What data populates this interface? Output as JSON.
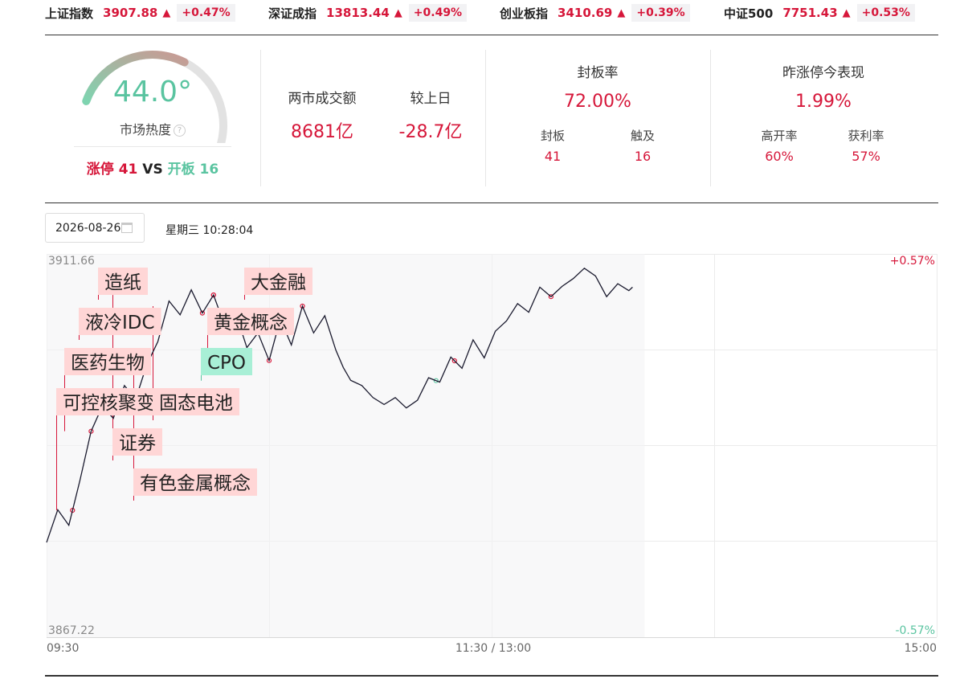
{
  "indices": [
    {
      "name": "上证指数",
      "value": "3907.88",
      "change": "+0.47%"
    },
    {
      "name": "深证成指",
      "value": "13813.44",
      "change": "+0.49%"
    },
    {
      "name": "创业板指",
      "value": "3410.69",
      "change": "+0.39%"
    },
    {
      "name": "中证500",
      "value": "7751.43",
      "change": "+0.53%"
    }
  ],
  "arrow_up": "▲",
  "heat": {
    "value": "44.0°",
    "heat_fraction": 0.44,
    "label": "市场热度",
    "help": "?",
    "limit_up_label": "涨停",
    "limit_up_count": "41",
    "vs": "VS",
    "open_label": "开板",
    "open_count": "16"
  },
  "turnover": {
    "label": "两市成交额",
    "value": "8681亿",
    "compare_label": "较上日",
    "compare_value": "-28.7亿"
  },
  "seal_rate": {
    "label": "封板率",
    "value": "72.00%",
    "sealed_label": "封板",
    "sealed_value": "41",
    "touched_label": "触及",
    "touched_value": "16"
  },
  "yesterday_limit_up": {
    "label": "昨涨停今表现",
    "value": "1.99%",
    "high_open_label": "高开率",
    "high_open_value": "60%",
    "profit_label": "获利率",
    "profit_value": "57%"
  },
  "date_picker": {
    "value": "2026-08-26"
  },
  "weekday_time": "星期三 10:28:04",
  "colors": {
    "up": "#d6173a",
    "down": "#5ac4a0",
    "accent": "#5ac4a0"
  },
  "chart_data": {
    "type": "line",
    "y_max_label": "3911.66",
    "y_min_label": "3867.22",
    "pct_max_label": "+0.57%",
    "pct_min_label": "-0.57%",
    "x_tick_labels": [
      "09:30",
      "11:30 / 13:00",
      "15:00"
    ],
    "ylim": [
      3867.22,
      3911.66
    ],
    "session_minutes": 240,
    "grid": true,
    "series": [
      {
        "x": [
          0,
          3,
          6,
          9,
          12,
          15,
          18,
          21,
          24,
          27,
          30,
          33,
          36,
          39,
          42,
          45,
          48,
          51,
          54,
          57,
          60,
          63,
          66,
          69,
          72,
          75,
          78,
          80,
          82,
          85,
          88,
          91,
          94,
          97,
          100,
          103,
          106,
          109,
          112,
          115,
          118,
          121,
          124,
          127,
          130,
          133,
          136,
          139,
          142,
          145,
          148,
          151,
          154,
          157,
          158
        ],
        "values": [
          3878.2,
          3882.0,
          3880.2,
          3885.4,
          3891.1,
          3894.0,
          3892.6,
          3896.4,
          3894.8,
          3898.8,
          3901.5,
          3906.2,
          3904.6,
          3907.5,
          3904.8,
          3906.9,
          3903.4,
          3904.8,
          3900.8,
          3902.5,
          3899.3,
          3904.1,
          3901.1,
          3905.6,
          3902.5,
          3904.5,
          3900.5,
          3898.5,
          3897.0,
          3896.4,
          3895.0,
          3894.2,
          3895.0,
          3893.8,
          3894.7,
          3897.3,
          3896.8,
          3899.7,
          3898.4,
          3901.7,
          3899.6,
          3902.7,
          3903.9,
          3905.9,
          3904.9,
          3907.8,
          3906.7,
          3907.9,
          3908.8,
          3910.0,
          3909.1,
          3906.7,
          3908.2,
          3907.4,
          3907.8
        ]
      }
    ],
    "annotations": [
      {
        "text": "造纸",
        "x": 45,
        "type": "up"
      },
      {
        "text": "液冷IDC",
        "x": 42,
        "type": "up"
      },
      {
        "text": "医药生物",
        "x": 12,
        "type": "up"
      },
      {
        "text": "可控核聚变",
        "x": 7,
        "type": "up"
      },
      {
        "text": "固态电池",
        "x": 69,
        "type": "up"
      },
      {
        "text": "证券",
        "x": 45,
        "type": "up"
      },
      {
        "text": "有色金属概念",
        "x": 60,
        "type": "up"
      },
      {
        "text": "大金融",
        "x": 136,
        "type": "up"
      },
      {
        "text": "黄金概念",
        "x": 110,
        "type": "up"
      },
      {
        "text": "CPO",
        "x": 105,
        "type": "down"
      }
    ]
  }
}
